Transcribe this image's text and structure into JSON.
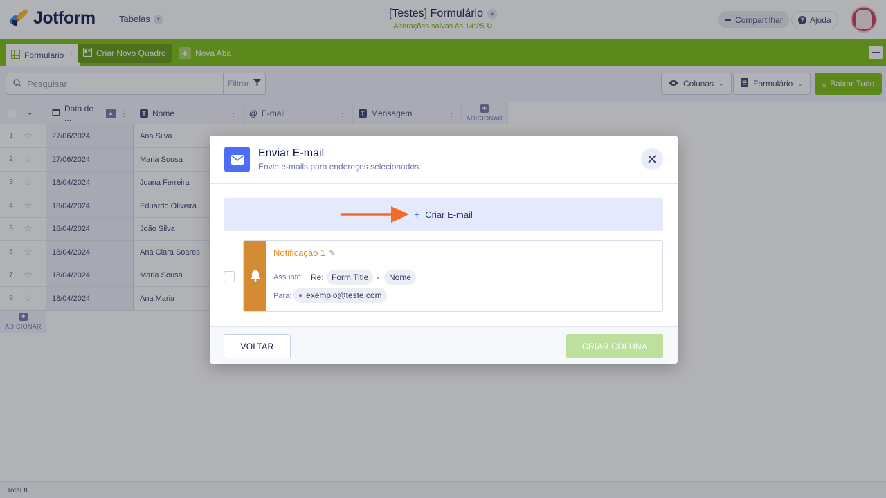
{
  "header": {
    "logo_text": "Jotform",
    "tables_menu": "Tabelas",
    "form_title": "[Testes] Formulário",
    "saved_status": "Alterações salvas às 14:25",
    "share_label": "Compartilhar",
    "help_label": "Ajuda"
  },
  "tabs": {
    "active_label": "Formulário",
    "new_board_label": "Criar Novo Quadro",
    "new_tab_label": "Nova Aba"
  },
  "toolbar": {
    "search_placeholder": "Pesquisar",
    "filter_label": "Filtrar",
    "columns_label": "Colunas",
    "form_label": "Formulário",
    "download_label": "Baixar Tudo"
  },
  "table": {
    "columns": [
      {
        "label": "Data de ..."
      },
      {
        "label": "Nome"
      },
      {
        "label": "E-mail"
      },
      {
        "label": "Mensagem"
      }
    ],
    "add_column_label": "ADICIONAR",
    "add_row_label": "ADICIONAR",
    "rows": [
      {
        "num": "1",
        "date": "27/06/2024",
        "name": "Ana Silva"
      },
      {
        "num": "2",
        "date": "27/06/2024",
        "name": "Maria Sousa"
      },
      {
        "num": "3",
        "date": "18/04/2024",
        "name": "Joana Ferreira"
      },
      {
        "num": "4",
        "date": "18/04/2024",
        "name": "Eduardo Oliveira"
      },
      {
        "num": "5",
        "date": "18/04/2024",
        "name": "João Silva"
      },
      {
        "num": "6",
        "date": "18/04/2024",
        "name": "Ana Clara Soares"
      },
      {
        "num": "7",
        "date": "18/04/2024",
        "name": "Maria Sousa"
      },
      {
        "num": "8",
        "date": "18/04/2024",
        "name": "Ana Maria"
      }
    ],
    "total_label": "Total",
    "total_count": "8"
  },
  "modal": {
    "title": "Enviar E-mail",
    "subtitle": "Envie e-mails para endereços selecionados.",
    "create_email_label": "Criar E-mail",
    "notification": {
      "name": "Notificação 1",
      "subject_label": "Assunto:",
      "subject_prefix": "Re:",
      "subject_field_1": "Form Title",
      "subject_separator": "-",
      "subject_field_2": "Nome",
      "to_label": "Para:",
      "to_value": "exemplo@teste.com"
    },
    "back_label": "VOLTAR",
    "create_column_label": "CRIAR COLUNA"
  },
  "colors": {
    "brand_green": "#78bb07",
    "accent_blue": "#4c6ef5",
    "notification_orange": "#d48b34",
    "arrow_orange": "#f26b2a"
  }
}
